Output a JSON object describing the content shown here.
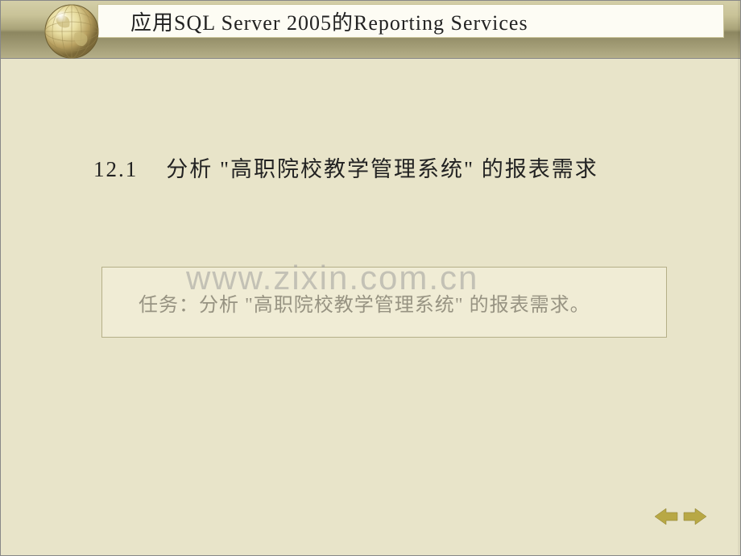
{
  "header": {
    "title": "应用SQL Server 2005的Reporting Services"
  },
  "content": {
    "section_number": "12.1",
    "section_title": "分析 \"高职院校教学管理系统\" 的报表需求",
    "task_label": "任务：分析 \"高职院校教学管理系统\" 的报表需求。"
  },
  "watermark": "www.zixin.com.cn",
  "nav": {
    "prev": "previous",
    "next": "next"
  },
  "colors": {
    "slide_bg": "#e8e4c9",
    "header_gradient_top": "#d4cfa8",
    "header_gradient_bottom": "#b5af88",
    "title_bg": "#fdfcf4",
    "task_bg": "#f0ecd5",
    "arrow_color": "#b8a845"
  }
}
